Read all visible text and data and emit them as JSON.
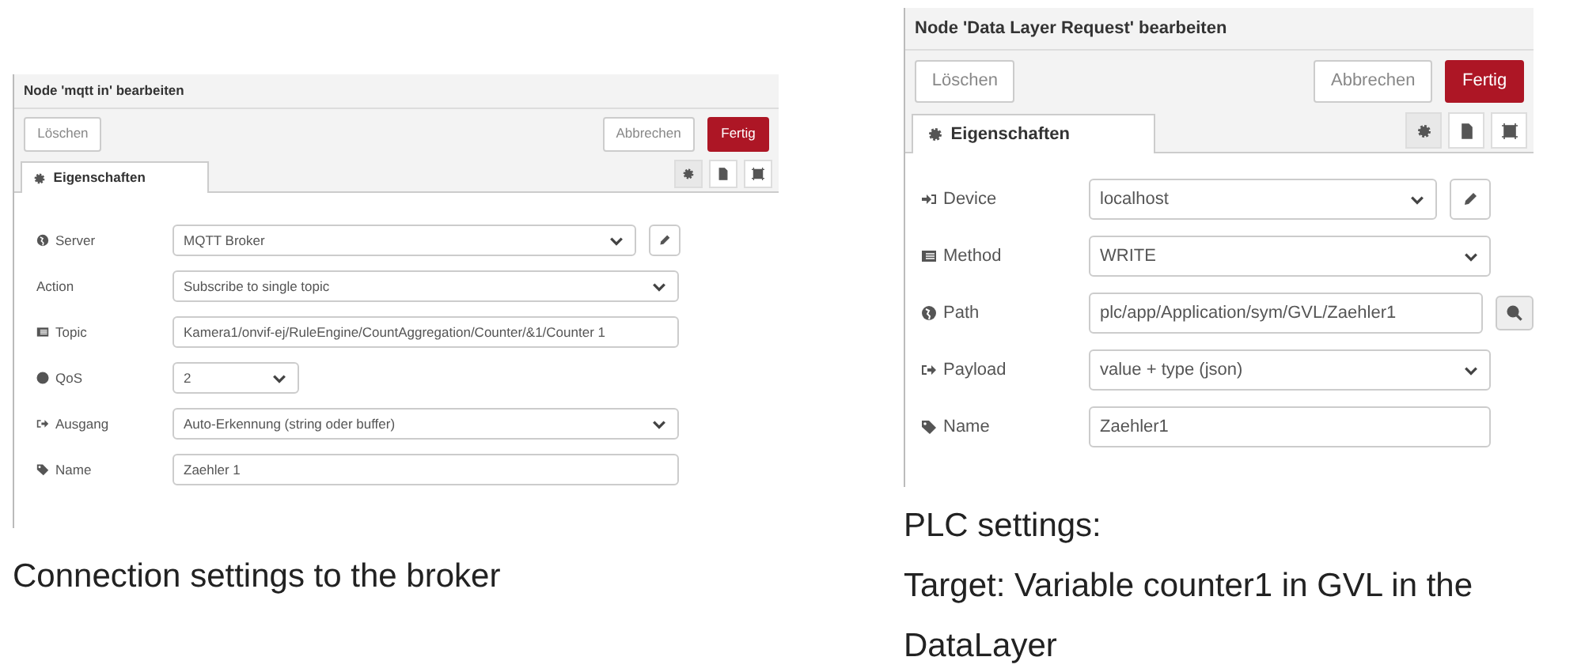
{
  "dialogs": [
    {
      "title": "Node 'mqtt in' bearbeiten",
      "buttons": [
        {
          "label": "Löschen",
          "kind": "plain"
        },
        {
          "label": "Abbrechen",
          "kind": "plain"
        },
        {
          "label": "Fertig",
          "kind": "primary"
        }
      ],
      "tabs": [
        {
          "label": "Eigenschaften",
          "selected": true
        }
      ],
      "side_tabs": [
        {
          "selected": true
        },
        {
          "selected": false
        },
        {
          "selected": false
        }
      ],
      "rows": [
        {
          "label": "Server",
          "kind": "select",
          "value": "MQTT Broker",
          "action": {
            "kind": "edit"
          }
        },
        {
          "label": "Action",
          "kind": "select",
          "value": "Subscribe to single topic"
        },
        {
          "label": "Topic",
          "kind": "input",
          "value": "Kamera1/onvif-ej/RuleEngine/CountAggregation/Counter/&1/Counter 1"
        },
        {
          "label": "QoS",
          "kind": "narrow-select",
          "value": "2"
        },
        {
          "label": "Ausgang",
          "kind": "select",
          "value": "Auto-Erkennung (string oder buffer)"
        },
        {
          "label": "Name",
          "kind": "input",
          "value": "Zaehler 1"
        }
      ],
      "caption": [
        "Connection settings to the broker"
      ]
    },
    {
      "title": "Node 'Data Layer Request' bearbeiten",
      "buttons": [
        {
          "label": "Löschen",
          "kind": "plain"
        },
        {
          "label": "Abbrechen",
          "kind": "plain"
        },
        {
          "label": "Fertig",
          "kind": "primary"
        }
      ],
      "tabs": [
        {
          "label": "Eigenschaften",
          "selected": true
        }
      ],
      "side_tabs": [
        {
          "selected": true
        },
        {
          "selected": false
        },
        {
          "selected": false
        }
      ],
      "rows": [
        {
          "label": "Device",
          "kind": "select",
          "value": "localhost",
          "action": {
            "kind": "edit"
          }
        },
        {
          "label": "Method",
          "kind": "select",
          "value": "WRITE"
        },
        {
          "label": "Path",
          "kind": "input",
          "value": "plc/app/Application/sym/GVL/Zaehler1",
          "action": {
            "kind": "search"
          }
        },
        {
          "label": "Payload",
          "kind": "select",
          "value": "value + type (json)"
        },
        {
          "label": "Name",
          "kind": "input",
          "value": "Zaehler1"
        }
      ],
      "caption": [
        "PLC settings:",
        "Target: Variable counter1 in GVL in the DataLayer"
      ]
    }
  ]
}
